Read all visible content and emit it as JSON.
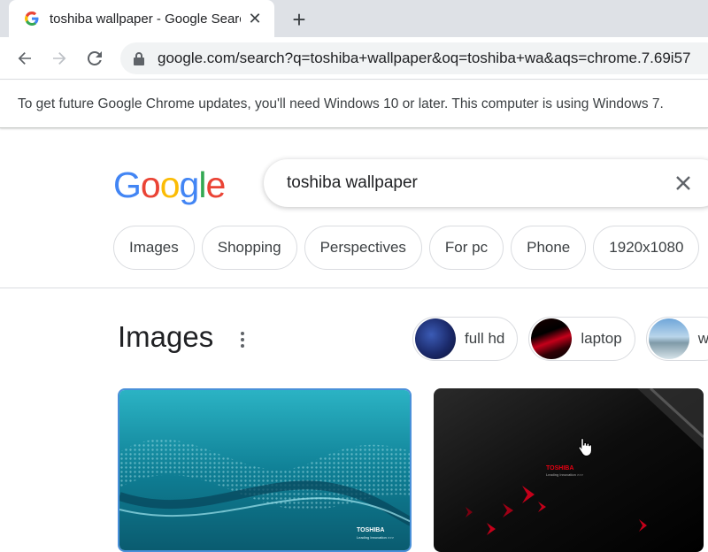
{
  "browser": {
    "tab_title": "toshiba wallpaper - Google Searc",
    "url": "google.com/search?q=toshiba+wallpaper&oq=toshiba+wa&aqs=chrome.7.69i57",
    "new_tab_label": "+",
    "close_tab_label": "✕"
  },
  "infobar": {
    "message": "To get future Google Chrome updates, you'll need Windows 10 or later. This computer is using Windows 7."
  },
  "google": {
    "logo": [
      "G",
      "o",
      "o",
      "g",
      "l",
      "e"
    ],
    "logo_colors": [
      "#4285F4",
      "#EA4335",
      "#FBBC05",
      "#4285F4",
      "#34A853",
      "#EA4335"
    ],
    "search_query": "toshiba wallpaper"
  },
  "chips": [
    "Images",
    "Shopping",
    "Perspectives",
    "For pc",
    "Phone",
    "1920x1080"
  ],
  "images_section": {
    "title": "Images",
    "related": [
      {
        "label": "full hd",
        "icon": "toshiba-thumb-blue"
      },
      {
        "label": "laptop",
        "icon": "toshiba-thumb-red"
      },
      {
        "label": "wi",
        "icon": "landscape-thumb"
      }
    ],
    "results": [
      {
        "brand": "TOSHIBA",
        "tagline": "Leading Innovation >>>"
      },
      {
        "brand": "TOSHIBA",
        "tagline": "Leading Innovation >>>"
      }
    ]
  },
  "colors": {
    "tabstrip": "#dee1e6",
    "omnibox": "#f1f3f4",
    "toshiba_red": "#e60012"
  }
}
